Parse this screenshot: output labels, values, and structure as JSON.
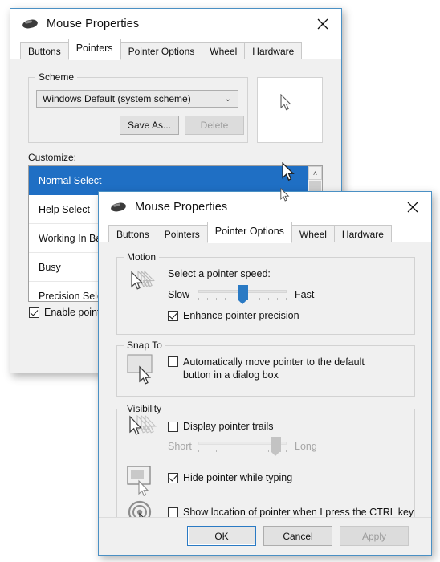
{
  "back_window": {
    "title": "Mouse Properties",
    "icon": "mouse-icon",
    "close_label": "✕",
    "tabs": [
      {
        "label": "Buttons",
        "active": false
      },
      {
        "label": "Pointers",
        "active": true
      },
      {
        "label": "Pointer Options",
        "active": false
      },
      {
        "label": "Wheel",
        "active": false
      },
      {
        "label": "Hardware",
        "active": false
      }
    ],
    "scheme": {
      "group_label": "Scheme",
      "combo_value": "Windows Default (system scheme)",
      "combo_chevron": "⌄",
      "save_as_label": "Save As...",
      "delete_label": "Delete",
      "delete_disabled": true
    },
    "customize": {
      "label": "Customize:",
      "items": [
        {
          "label": "Normal Select",
          "selected": true
        },
        {
          "label": "Help Select",
          "selected": false
        },
        {
          "label": "Working In Backg",
          "selected": false
        },
        {
          "label": "Busy",
          "selected": false
        },
        {
          "label": "Precision Select",
          "selected": false
        }
      ],
      "scroll_up_glyph": "˄"
    },
    "enable_shadow": {
      "label": "Enable pointer",
      "checked": true
    }
  },
  "front_window": {
    "title": "Mouse Properties",
    "icon": "mouse-icon",
    "close_label": "✕",
    "tabs": [
      {
        "label": "Buttons",
        "active": false
      },
      {
        "label": "Pointers",
        "active": false
      },
      {
        "label": "Pointer Options",
        "active": true
      },
      {
        "label": "Wheel",
        "active": false
      },
      {
        "label": "Hardware",
        "active": false
      }
    ],
    "motion": {
      "group_label": "Motion",
      "speed_label": "Select a pointer speed:",
      "slow_label": "Slow",
      "fast_label": "Fast",
      "slider_percent": 50,
      "enhance": {
        "label": "Enhance pointer precision",
        "checked": true
      }
    },
    "snap_to": {
      "group_label": "Snap To",
      "auto_move": {
        "label": "Automatically move pointer to the default button in a dialog box",
        "checked": false
      }
    },
    "visibility": {
      "group_label": "Visibility",
      "trails": {
        "label": "Display pointer trails",
        "checked": false
      },
      "trails_short_label": "Short",
      "trails_long_label": "Long",
      "trails_percent": 88,
      "trails_disabled": true,
      "hide_typing": {
        "label": "Hide pointer while typing",
        "checked": true
      },
      "show_ctrl": {
        "label": "Show location of pointer when I press the CTRL key",
        "checked": false
      }
    },
    "footer": {
      "ok_label": "OK",
      "cancel_label": "Cancel",
      "apply_label": "Apply",
      "apply_disabled": true
    }
  },
  "colors": {
    "accent": "#2a7ac4",
    "window_border": "#4a90c4",
    "selection": "#1f6fc4",
    "chrome": "#f0f0f0"
  }
}
